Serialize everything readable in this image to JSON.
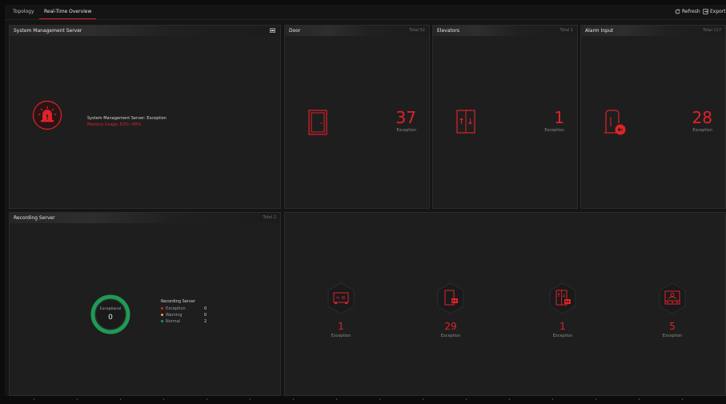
{
  "tabs": [
    {
      "label": "Topology"
    },
    {
      "label": "Real-Time Overview"
    }
  ],
  "toolbar": {
    "refresh_label": "Refresh",
    "export_label": "Export"
  },
  "colors": {
    "accent": "#e0222b",
    "normal": "#1e9a55",
    "warning": "#f0a72c"
  },
  "system_server": {
    "title": "System Management Server",
    "status_text": "System Management Server: Exception",
    "memory_text": "Memory Usage: 83%~90%",
    "icon": "alarm-siren-icon"
  },
  "door": {
    "title": "Door",
    "total": "Total 52",
    "count": "37",
    "label": "Exception",
    "icon": "door-icon"
  },
  "elevators": {
    "title": "Elevators",
    "total": "Total 1",
    "count": "1",
    "label": "Exception",
    "icon": "elevator-icon"
  },
  "alarm_input": {
    "title": "Alarm Input",
    "total": "Total 117",
    "count": "28",
    "label": "Exception",
    "icon": "alarm-input-icon"
  },
  "recording_server": {
    "title": "Recording Server",
    "total": "Total 2",
    "ring_label": "Exceptional",
    "ring_value": "0",
    "legend_title": "Recording Server",
    "legend": [
      {
        "name": "Exception",
        "value": "0",
        "color": "#e0222b"
      },
      {
        "name": "Warning",
        "value": "0",
        "color": "#f0a72c"
      },
      {
        "name": "Normal",
        "value": "2",
        "color": "#1e9a55"
      }
    ]
  },
  "devices": [
    {
      "icon": "controller-device-icon",
      "count": "1",
      "label": "Exception"
    },
    {
      "icon": "door-station-icon",
      "count": "29",
      "label": "Exception"
    },
    {
      "icon": "elevator-station-icon",
      "count": "1",
      "label": "Exception"
    },
    {
      "icon": "indoor-station-icon",
      "count": "5",
      "label": "Exception"
    }
  ]
}
